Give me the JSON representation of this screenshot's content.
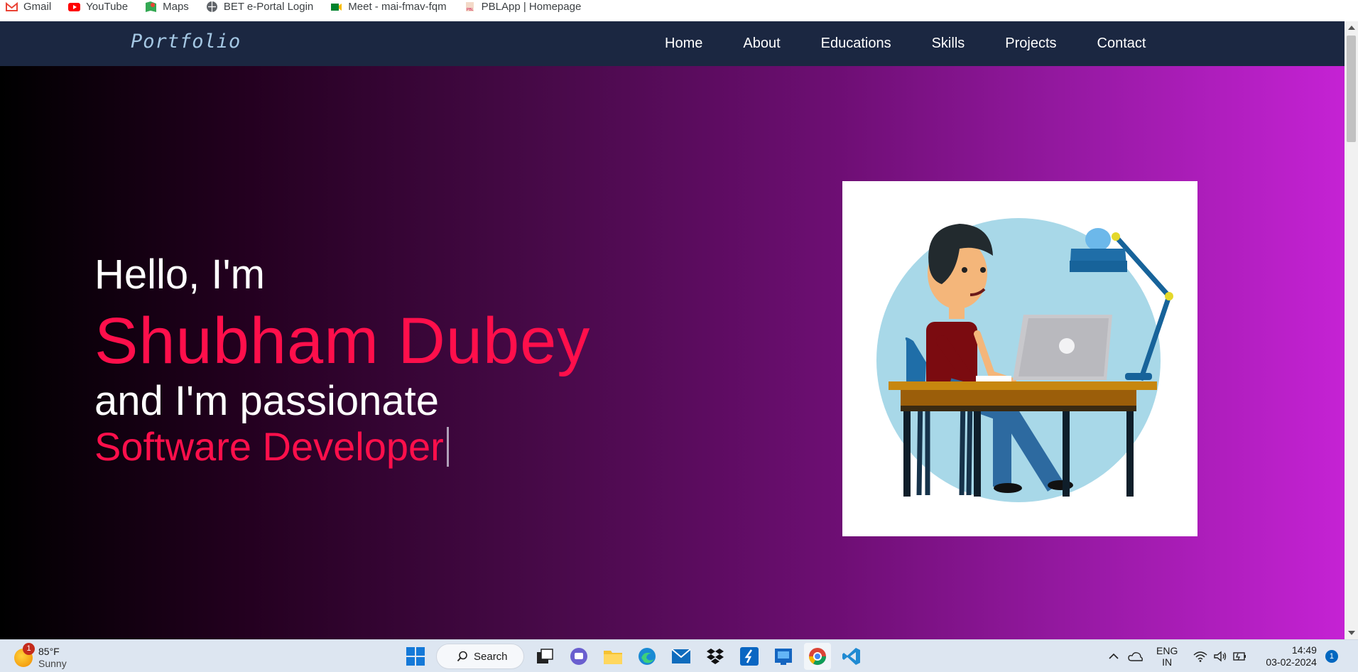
{
  "bookmarks": [
    {
      "label": "Gmail",
      "icon": "gmail-icon"
    },
    {
      "label": "YouTube",
      "icon": "youtube-icon"
    },
    {
      "label": "Maps",
      "icon": "maps-icon"
    },
    {
      "label": "BET e-Portal Login",
      "icon": "globe-icon"
    },
    {
      "label": "Meet - mai-fmav-fqm",
      "icon": "meet-icon"
    },
    {
      "label": "PBLApp | Homepage",
      "icon": "pblapp-icon"
    }
  ],
  "navbar": {
    "logo": "Portfolio",
    "links": [
      "Home",
      "About",
      "Educations",
      "Skills",
      "Projects",
      "Contact"
    ]
  },
  "hero": {
    "greeting": "Hello, I'm",
    "name": "Shubham Dubey",
    "passion": "and I'm passionate",
    "role": "Software Developer"
  },
  "colors": {
    "navbar_bg": "#1b2741",
    "accent": "#ff0f4b",
    "logo": "#a5c8e4"
  },
  "taskbar": {
    "weather": {
      "temp": "85°F",
      "condition": "Sunny",
      "badge": "1"
    },
    "search_label": "Search",
    "apps": [
      "windows-start-icon",
      "task-view-icon",
      "teams-chat-icon",
      "file-explorer-icon",
      "edge-icon",
      "mail-icon",
      "dropbox-icon",
      "app-blue-s-icon",
      "app-blue-icon",
      "chrome-icon",
      "vscode-icon"
    ],
    "lang_line1": "ENG",
    "lang_line2": "IN",
    "time": "14:49",
    "date": "03-02-2024",
    "notifications": "1"
  }
}
